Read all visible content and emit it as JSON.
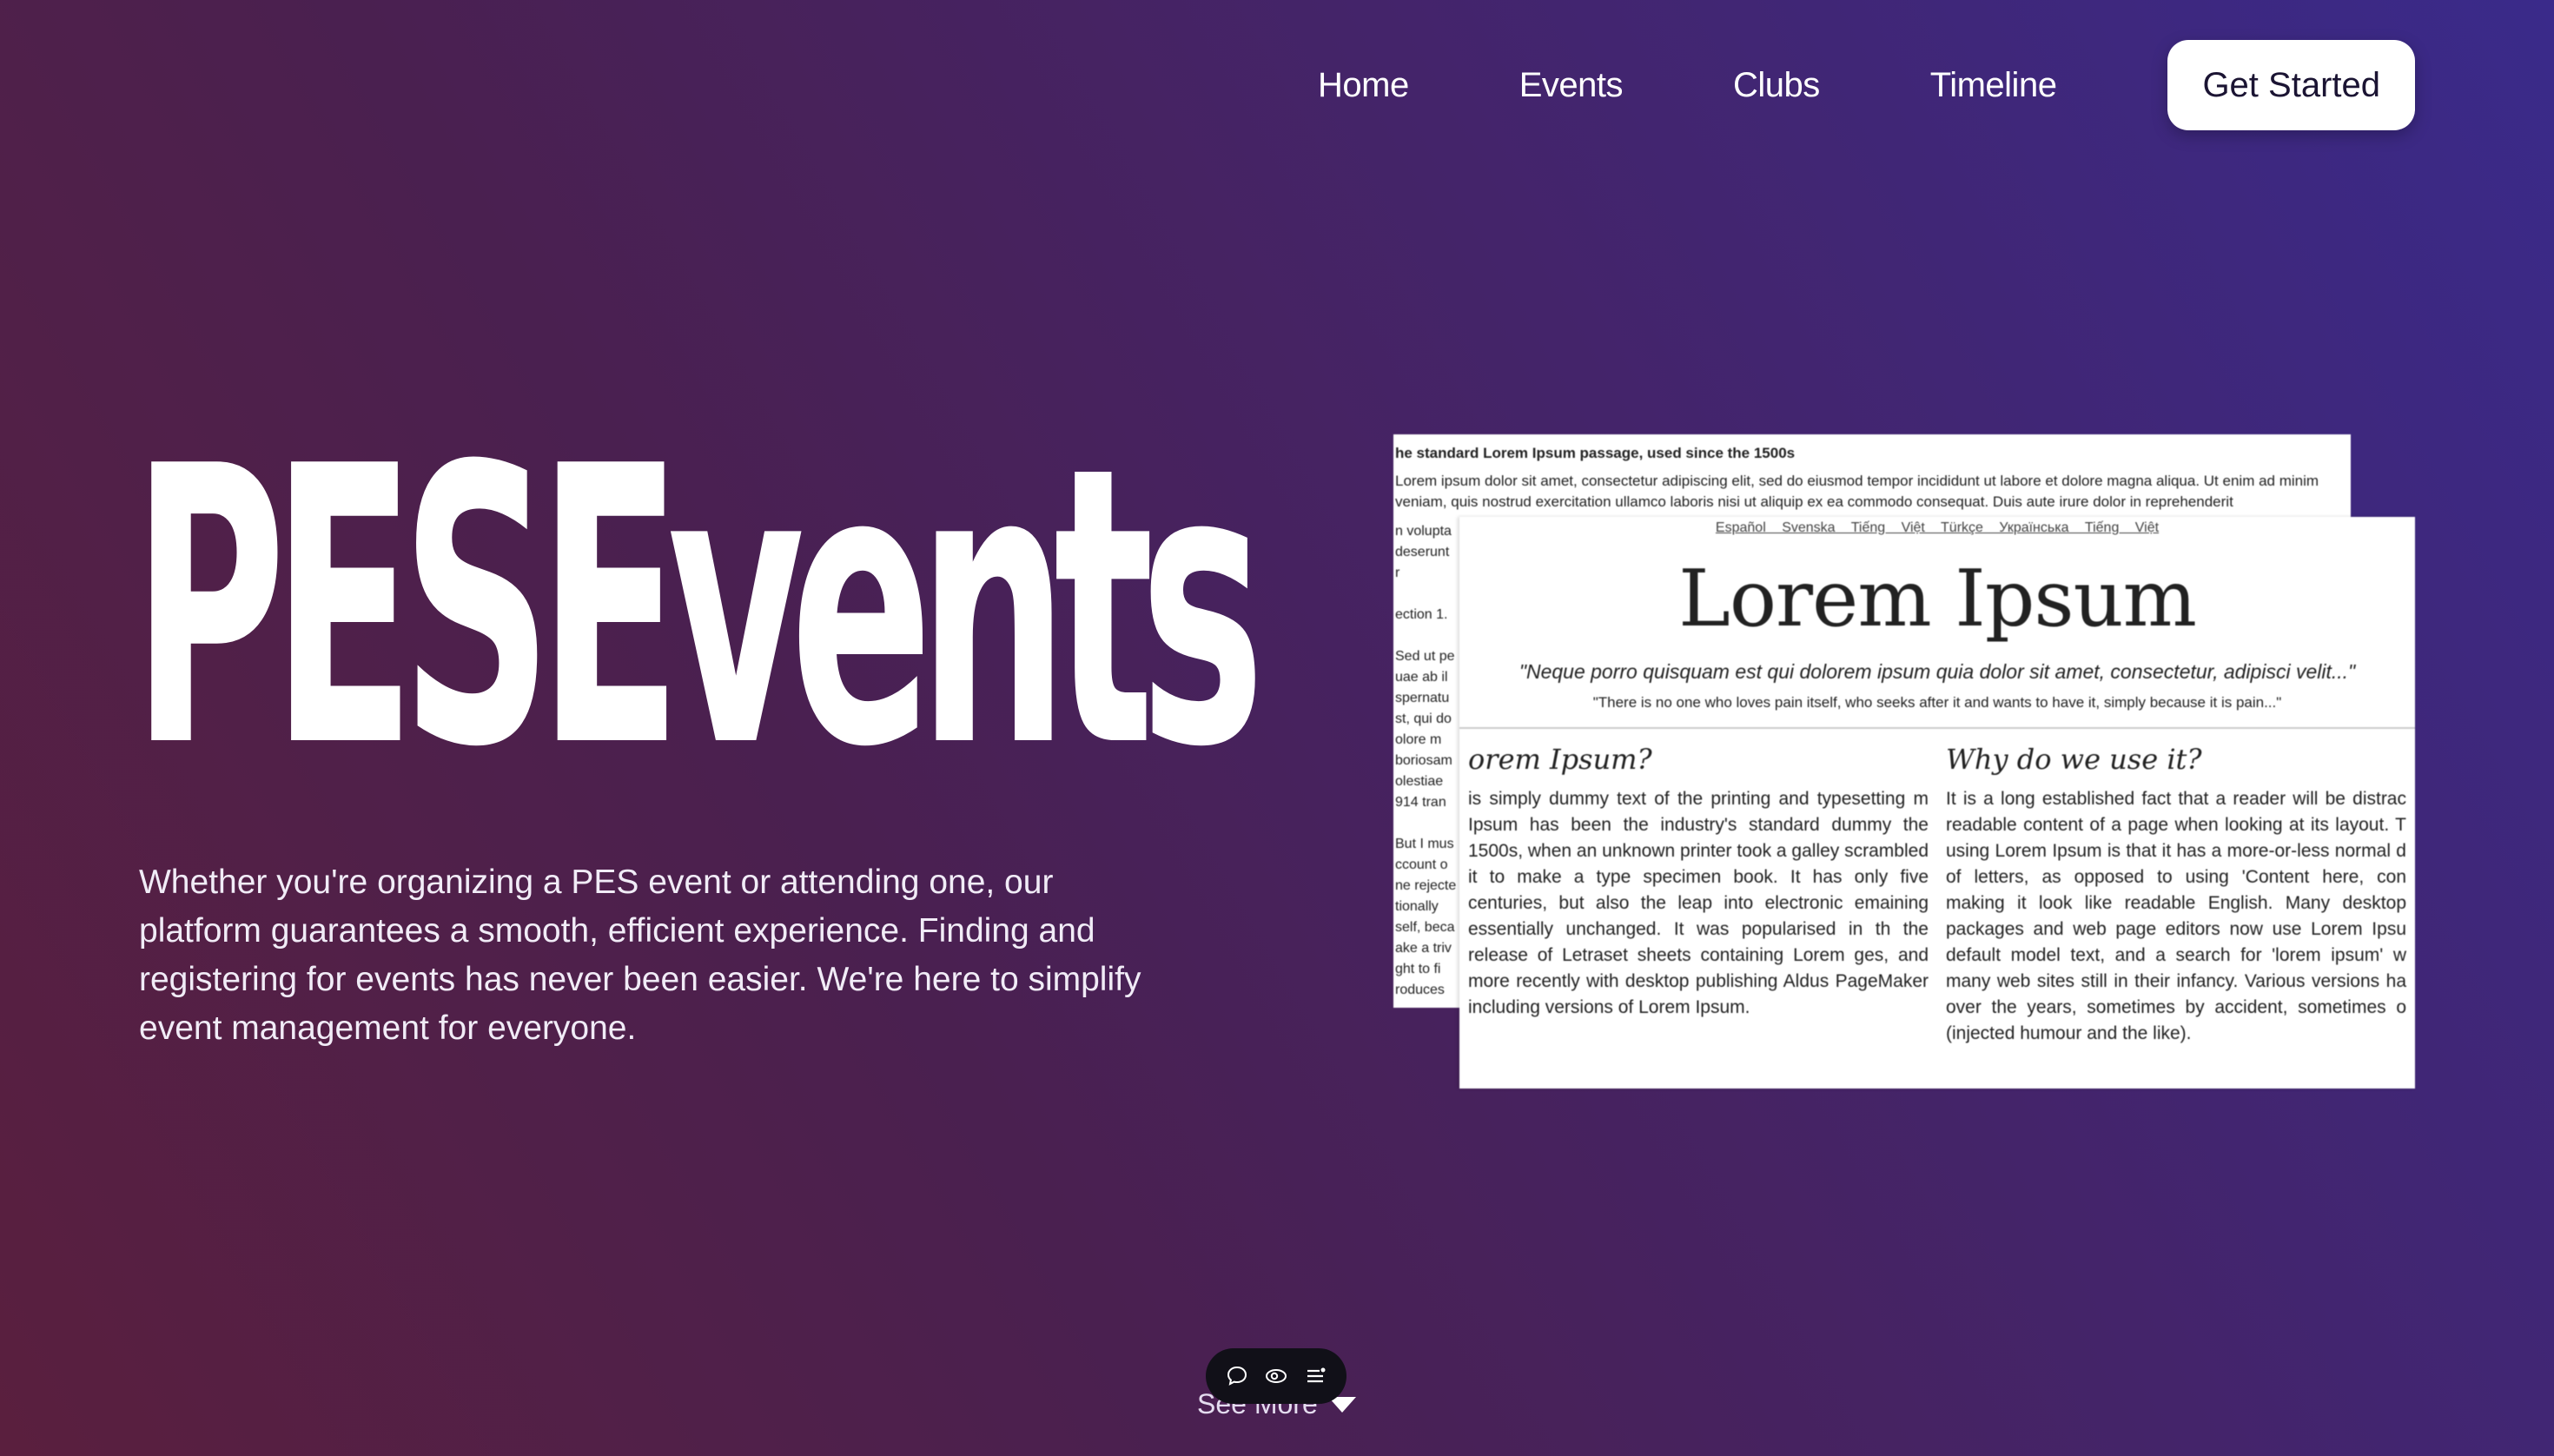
{
  "nav": {
    "links": [
      "Home",
      "Events",
      "Clubs",
      "Timeline"
    ],
    "cta": "Get Started"
  },
  "hero": {
    "title": "PESEvents",
    "description": "Whether you're organizing a PES event or attending one, our platform guarantees a smooth, efficient experience. Finding and registering for events has never been easier. We're here to simplify event management for everyone."
  },
  "preview": {
    "back": {
      "heading": "he standard Lorem Ipsum passage, used since the 1500s",
      "paragraph": "Lorem ipsum dolor sit amet, consectetur adipiscing elit, sed do eiusmod tempor incididunt ut labore et dolore magna aliqua. Ut enim ad minim veniam, quis nostrud exercitation ullamco laboris nisi ut aliquip ex ea commodo consequat. Duis aute irure dolor in reprehenderit",
      "side": "n volupta\ndeserunt r\n\nection 1.\n\nSed ut pe\nuae ab il\nspernatu\nst, qui do\nolore m\nboriosam\nolestiae\n914 tran\n\nBut I mus\nccount o\nne rejecte\ntionally\nself, beca\nake a triv\nght to fi\nroduces"
    },
    "front": {
      "languages": "Español Svenska Tiếng Việt Türkçe Українська Tiếng Việt",
      "title": "Lorem Ipsum",
      "quote": "\"Neque porro quisquam est qui dolorem ipsum quia dolor sit amet, consectetur, adipisci velit...\"",
      "quote_translation": "\"There is no one who loves pain itself, who seeks after it and wants to have it, simply because it is pain...\"",
      "col1_heading": "orem Ipsum?",
      "col1_text": "is simply dummy text of the printing and typesetting m Ipsum has been the industry's standard dummy the 1500s, when an unknown printer took a galley scrambled it to make a type specimen book. It has only five centuries, but also the leap into electronic emaining essentially unchanged. It was popularised in th the release of Letraset sheets containing Lorem ges, and more recently with desktop publishing Aldus PageMaker including versions of Lorem Ipsum.",
      "col2_heading": "Why do we use it?",
      "col2_text": "It is a long established fact that a reader will be distrac readable content of a page when looking at its layout. T using Lorem Ipsum is that it has a more-or-less normal d of letters, as opposed to using 'Content here, con making it look like readable English. Many desktop packages and web page editors now use Lorem Ipsu default model text, and a search for 'lorem ipsum' w many web sites still in their infancy. Various versions ha over the years, sometimes by accident, sometimes o (injected humour and the like)."
    }
  },
  "see_more": "See More",
  "toolbar": {
    "icons": [
      "comment-icon",
      "eye-icon",
      "list-icon"
    ]
  }
}
